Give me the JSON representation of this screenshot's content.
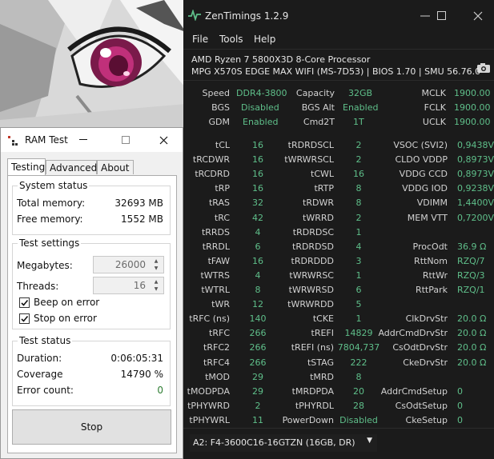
{
  "zentimings": {
    "title": "ZenTimings 1.2.9",
    "menu": [
      "File",
      "Tools",
      "Help"
    ],
    "cpu": "AMD Ryzen 7 5800X3D 8-Core Processor",
    "board": "MPG X570S EDGE MAX WIFI (MS-7D53) | BIOS 1.70 | SMU 56.76.0",
    "top": {
      "speed_label": "Speed",
      "speed": "DDR4-3800",
      "capacity_label": "Capacity",
      "capacity": "32GB",
      "mclk_label": "MCLK",
      "mclk": "1900.00",
      "bgs_label": "BGS",
      "bgs": "Disabled",
      "bgsalt_label": "BGS Alt",
      "bgsalt": "Enabled",
      "fclk_label": "FCLK",
      "fclk": "1900.00",
      "gdm_label": "GDM",
      "gdm": "Enabled",
      "cmd2t_label": "Cmd2T",
      "cmd2t": "1T",
      "uclk_label": "UCLK",
      "uclk": "1900.00"
    },
    "timings": {
      "col1": [
        {
          "label": "tCL",
          "value": "16"
        },
        {
          "label": "tRCDWR",
          "value": "16"
        },
        {
          "label": "tRCDRD",
          "value": "16"
        },
        {
          "label": "tRP",
          "value": "16"
        },
        {
          "label": "tRAS",
          "value": "32"
        },
        {
          "label": "tRC",
          "value": "42"
        },
        {
          "label": "tRRDS",
          "value": "4"
        },
        {
          "label": "tRRDL",
          "value": "6"
        },
        {
          "label": "tFAW",
          "value": "16"
        },
        {
          "label": "tWTRS",
          "value": "4"
        },
        {
          "label": "tWTRL",
          "value": "8"
        },
        {
          "label": "tWR",
          "value": "12"
        },
        {
          "label": "tRFC (ns)",
          "value": "140"
        },
        {
          "label": "tRFC",
          "value": "266"
        },
        {
          "label": "tRFC2",
          "value": "266"
        },
        {
          "label": "tRFC4",
          "value": "266"
        },
        {
          "label": "tMOD",
          "value": "29"
        },
        {
          "label": "tMODPDA",
          "value": "29"
        },
        {
          "label": "tPHYWRD",
          "value": "2"
        },
        {
          "label": "tPHYWRL",
          "value": "11"
        }
      ],
      "col2": [
        {
          "label": "tRDRDSCL",
          "value": "2"
        },
        {
          "label": "tWRWRSCL",
          "value": "2"
        },
        {
          "label": "tCWL",
          "value": "16"
        },
        {
          "label": "tRTP",
          "value": "8"
        },
        {
          "label": "tRDWR",
          "value": "8"
        },
        {
          "label": "tWRRD",
          "value": "2"
        },
        {
          "label": "tRDRDSC",
          "value": "1"
        },
        {
          "label": "tRDRDSD",
          "value": "4"
        },
        {
          "label": "tRDRDDD",
          "value": "3"
        },
        {
          "label": "tWRWRSC",
          "value": "1"
        },
        {
          "label": "tWRWRSD",
          "value": "6"
        },
        {
          "label": "tWRWRDD",
          "value": "5"
        },
        {
          "label": "tCKE",
          "value": "1"
        },
        {
          "label": "tREFI",
          "value": "14829"
        },
        {
          "label": "tREFI (ns)",
          "value": "7804,737"
        },
        {
          "label": "tSTAG",
          "value": "222"
        },
        {
          "label": "tMRD",
          "value": "8"
        },
        {
          "label": "tMRDPDA",
          "value": "20"
        },
        {
          "label": "tPHYRDL",
          "value": "28"
        },
        {
          "label": "PowerDown",
          "value": "Disabled"
        }
      ],
      "col3_voltages": [
        {
          "label": "VSOC (SVI2)",
          "value": "0,9438V"
        },
        {
          "label": "CLDO VDDP",
          "value": "0,8973V"
        },
        {
          "label": "VDDG CCD",
          "value": "0,8973V"
        },
        {
          "label": "VDDG IOD",
          "value": "0,9238V"
        },
        {
          "label": "VDIMM",
          "value": "1,4400V"
        },
        {
          "label": "MEM VTT",
          "value": "0,7200V"
        }
      ],
      "col3_odt": [
        {
          "label": "ProcOdt",
          "value": "36.9 Ω"
        },
        {
          "label": "RttNom",
          "value": "RZQ/7"
        },
        {
          "label": "RttWr",
          "value": "RZQ/3"
        },
        {
          "label": "RttPark",
          "value": "RZQ/1"
        }
      ],
      "col3_drv": [
        {
          "label": "ClkDrvStr",
          "value": "20.0 Ω"
        },
        {
          "label": "AddrCmdDrvStr",
          "value": "20.0 Ω"
        },
        {
          "label": "CsOdtDrvStr",
          "value": "20.0 Ω"
        },
        {
          "label": "CkeDrvStr",
          "value": "20.0 Ω"
        }
      ],
      "col3_setup": [
        {
          "label": "AddrCmdSetup",
          "value": "0"
        },
        {
          "label": "CsOdtSetup",
          "value": "0"
        },
        {
          "label": "CkeSetup",
          "value": "0"
        }
      ]
    },
    "dimm_selected": "A2: F4-3600C16-16GTZN (16GB, DR)"
  },
  "ramtest": {
    "title": "RAM Test",
    "tabs": [
      "Testing",
      "Advanced",
      "About"
    ],
    "system_status": {
      "title": "System status",
      "total_label": "Total memory:",
      "total": "32693 MB",
      "free_label": "Free memory:",
      "free": "1552 MB"
    },
    "test_settings": {
      "title": "Test settings",
      "megabytes_label": "Megabytes:",
      "megabytes": "26000",
      "threads_label": "Threads:",
      "threads": "16",
      "beep_label": "Beep on error",
      "beep_checked": true,
      "stop_label": "Stop on error",
      "stop_checked": true
    },
    "test_status": {
      "title": "Test status",
      "duration_label": "Duration:",
      "duration": "0:06:05:31",
      "coverage_label": "Coverage",
      "coverage": "14790 %",
      "errors_label": "Error count:",
      "errors": "0"
    },
    "stop_button": "Stop"
  },
  "colors": {
    "value_green": "#5fbf8a",
    "zt_bg": "#1b1b1b",
    "ramtest_bg": "#f0f0f0"
  }
}
